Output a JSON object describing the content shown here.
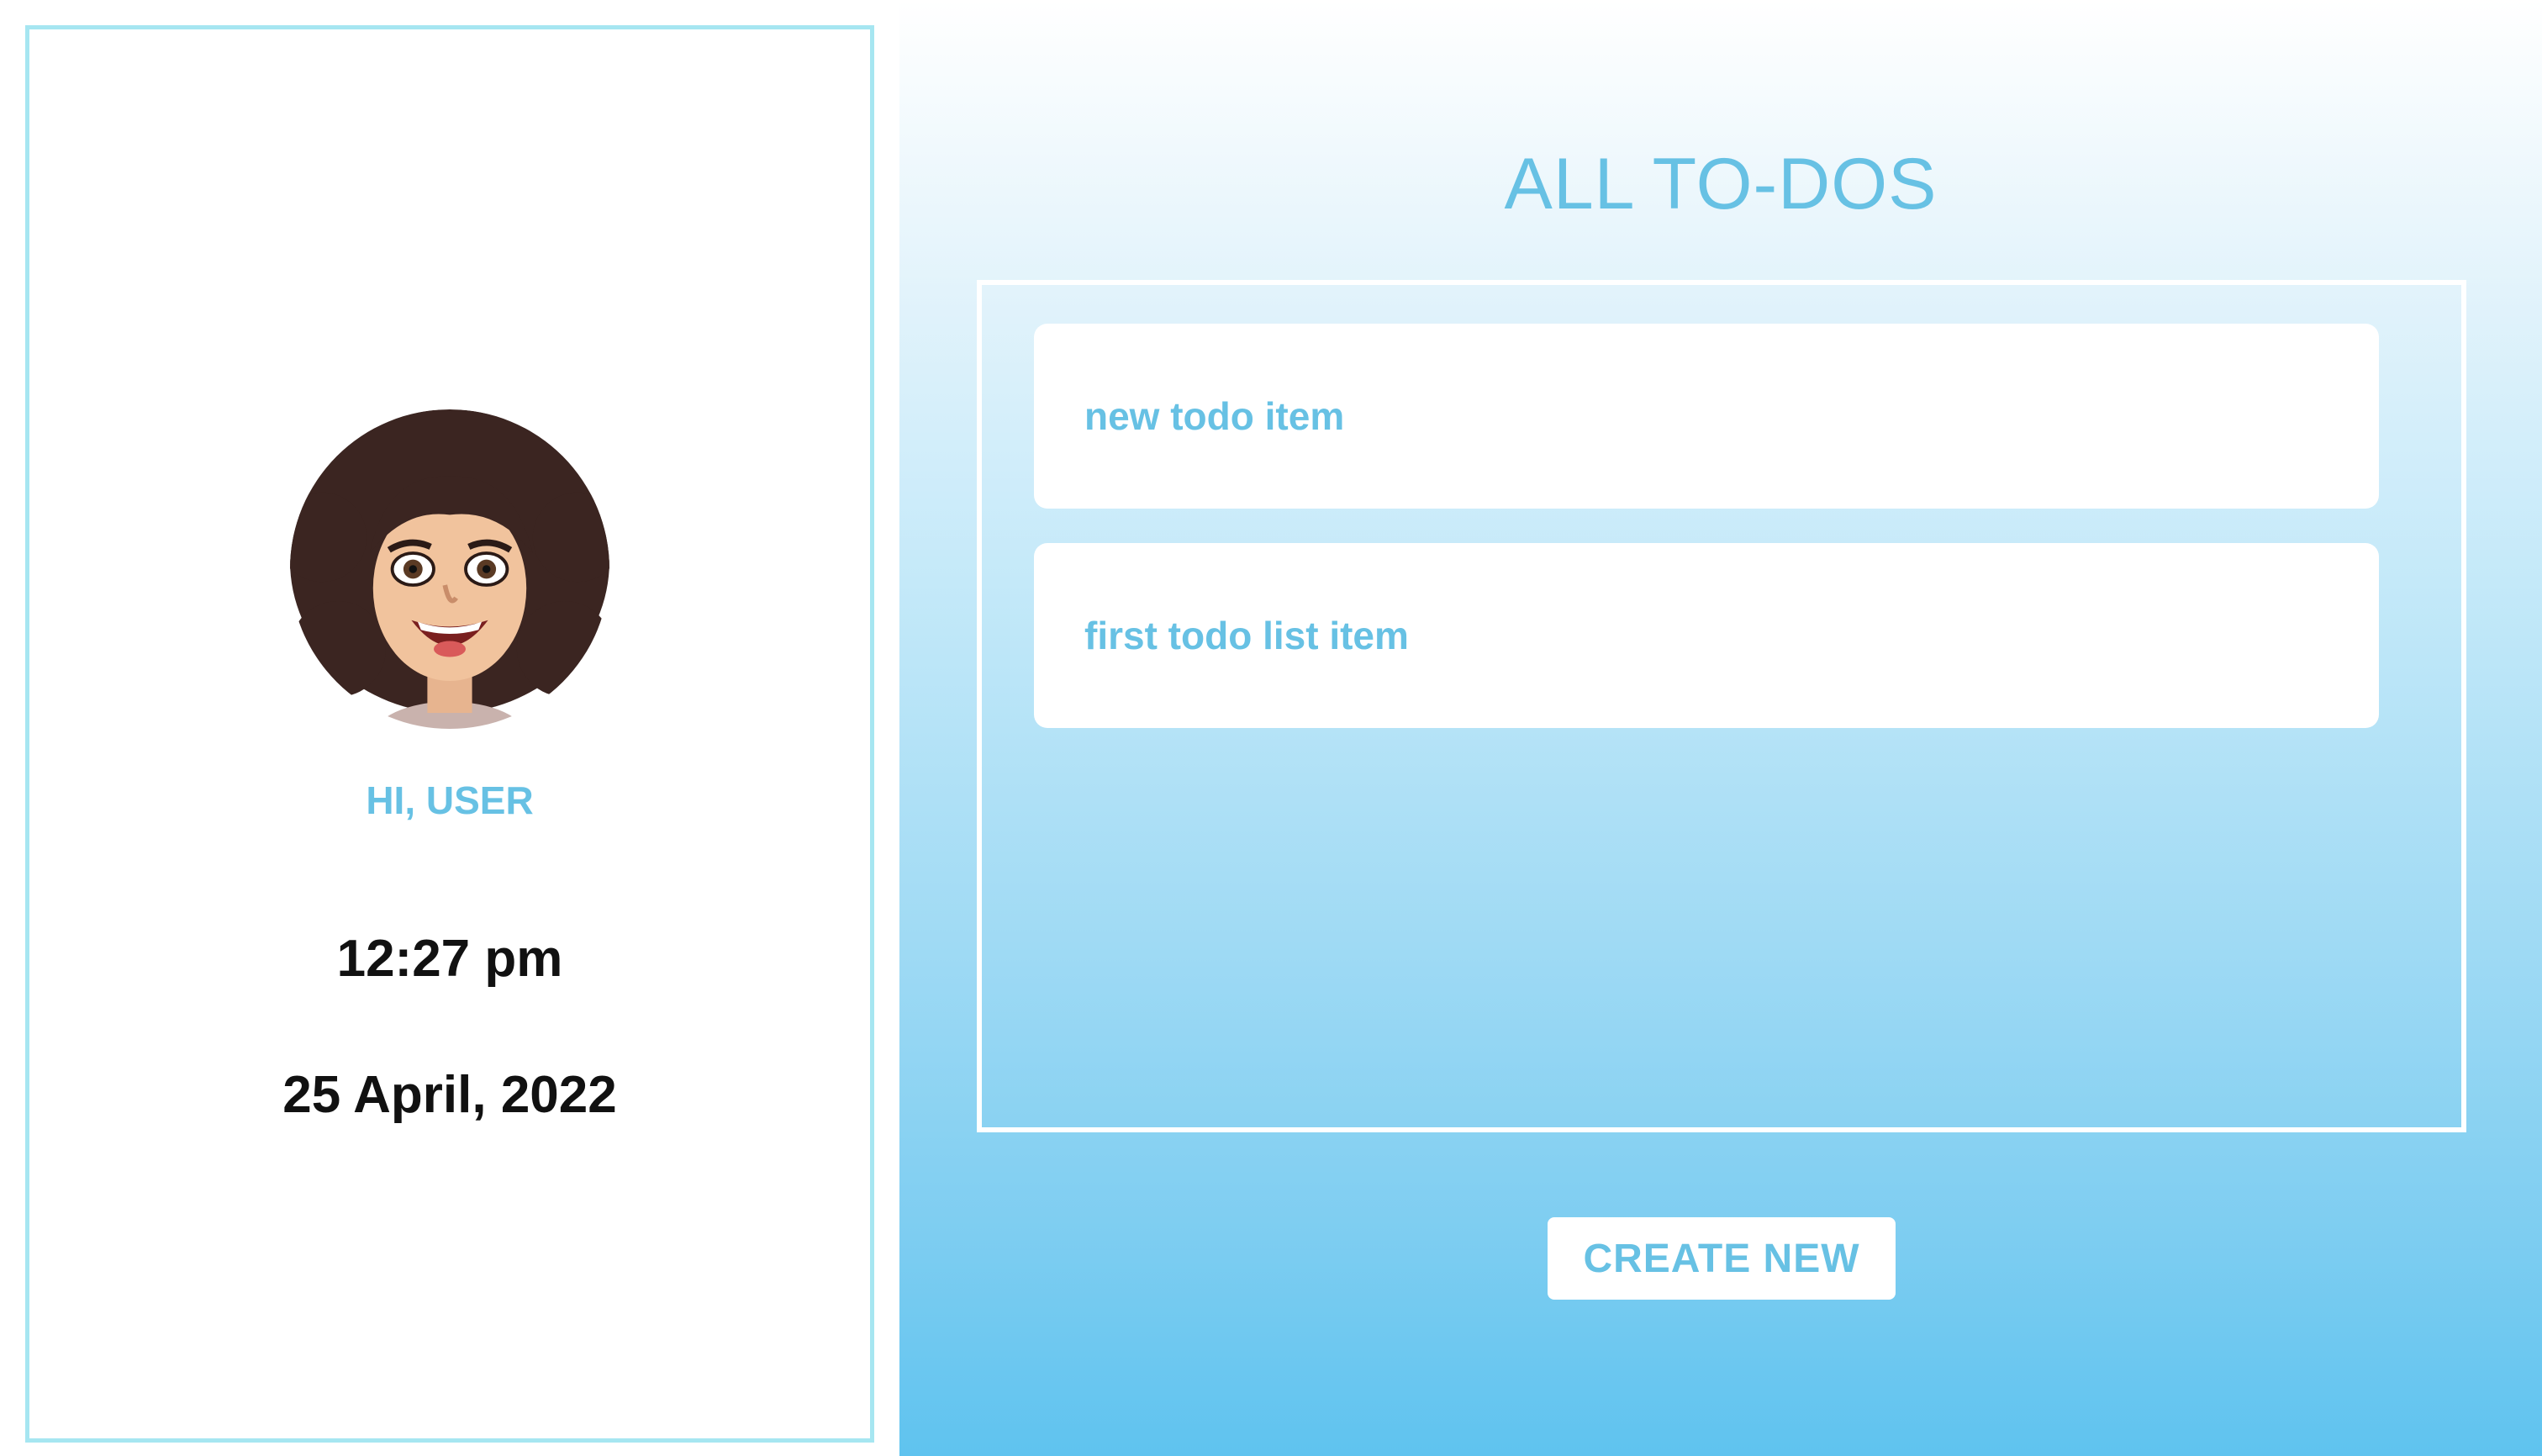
{
  "profile": {
    "greeting": "HI, USER",
    "time": "12:27 pm",
    "date": "25 April, 2022",
    "avatar_icon": "user-avatar-icon"
  },
  "main": {
    "title": "ALL TO-DOS",
    "todos": [
      {
        "label": "new todo item"
      },
      {
        "label": "first todo list item"
      }
    ],
    "create_button_label": "CREATE NEW"
  },
  "colors": {
    "accent": "#67c1e4",
    "panel_border": "#a6e6f1",
    "gradient_top": "#ffffff",
    "gradient_bottom": "#5fc3ef",
    "text_dark": "#111111"
  }
}
